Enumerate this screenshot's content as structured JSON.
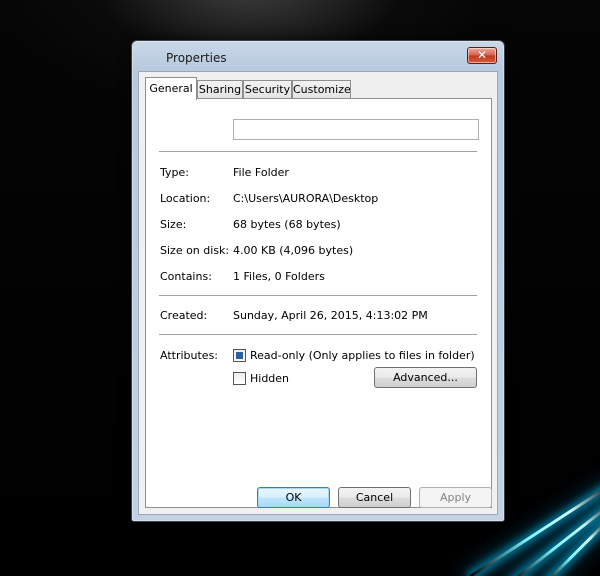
{
  "window": {
    "title": "Properties",
    "close_label": "✕"
  },
  "tabs": [
    {
      "label": "General",
      "active": true
    },
    {
      "label": "Sharing",
      "active": false
    },
    {
      "label": "Security",
      "active": false
    },
    {
      "label": "Customize",
      "active": false
    }
  ],
  "general": {
    "name_value": "",
    "fields": [
      {
        "label": "Type:",
        "value": "File Folder"
      },
      {
        "label": "Location:",
        "value": "C:\\Users\\AURORA\\Desktop"
      },
      {
        "label": "Size:",
        "value": "68 bytes (68 bytes)"
      },
      {
        "label": "Size on disk:",
        "value": "4.00 KB (4,096 bytes)"
      },
      {
        "label": "Contains:",
        "value": "1 Files, 0 Folders"
      }
    ],
    "created": {
      "label": "Created:",
      "value": "Sunday, April 26, 2015, 4:13:02 PM"
    },
    "attributes": {
      "label": "Attributes:",
      "readonly": {
        "label": "Read-only (Only applies to files in folder)",
        "checked": true
      },
      "hidden": {
        "label": "Hidden",
        "checked": false
      },
      "advanced_label": "Advanced..."
    }
  },
  "footer": {
    "ok_label": "OK",
    "cancel_label": "Cancel",
    "apply_label": "Apply"
  },
  "colors": {
    "checkbox_fill": "#2b5f9e",
    "close_button": "#c23a1e",
    "glow": "#7ff6ff"
  }
}
